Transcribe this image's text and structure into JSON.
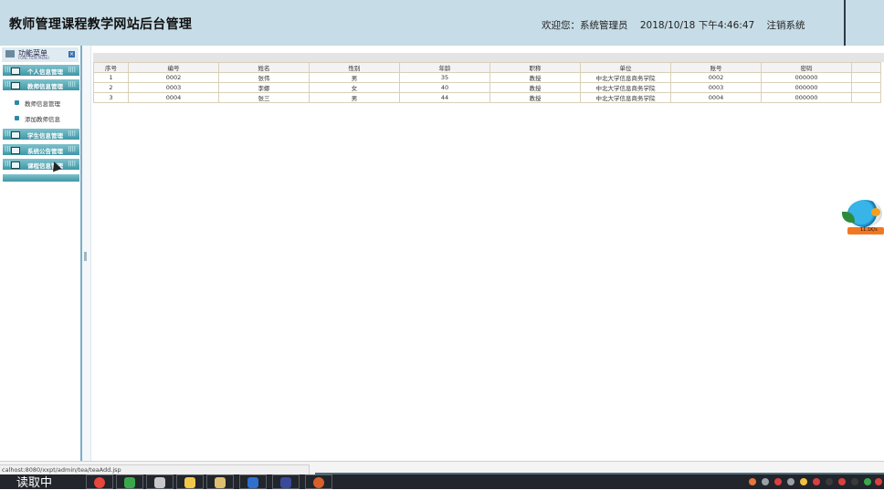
{
  "header": {
    "title": "教师管理课程教学网站后台管理",
    "welcome": "欢迎您：系统管理员",
    "datetime": "2018/10/18 下午4:46:47",
    "logout": "注销系统"
  },
  "sidebar": {
    "menu_title": "功能菜单",
    "menu_subtitle": "FUNCTION MENU",
    "groups": [
      {
        "label": "个人信息管理"
      },
      {
        "label": "教师信息管理",
        "children": [
          {
            "label": "教师信息管理"
          },
          {
            "label": "添加教师信息"
          }
        ]
      },
      {
        "label": "学生信息管理"
      },
      {
        "label": "系统公告管理"
      },
      {
        "label": "课程信息管理"
      }
    ]
  },
  "table": {
    "headers": [
      "序号",
      "编号",
      "姓名",
      "性别",
      "年龄",
      "职称",
      "单位",
      "账号",
      "密码",
      ""
    ],
    "rows": [
      [
        "1",
        "0002",
        "张伟",
        "男",
        "35",
        "教授",
        "中北大学信息商务学院",
        "0002",
        "000000",
        ""
      ],
      [
        "2",
        "0003",
        "李娜",
        "女",
        "40",
        "教授",
        "中北大学信息商务学院",
        "0003",
        "000000",
        ""
      ],
      [
        "3",
        "0004",
        "张三",
        "男",
        "44",
        "教授",
        "中北大学信息商务学院",
        "0004",
        "000000",
        ""
      ]
    ]
  },
  "widget": {
    "speed": "11.1K/s"
  },
  "statusbar": {
    "url": "calhost:8080/xxpt/admin/tea/teaAdd.jsp"
  },
  "taskbar": {
    "start_text": "读取中",
    "apps": [
      {
        "icon": "chrome-icon",
        "color": "#e8453c"
      },
      {
        "icon": "browser-green-icon",
        "color": "#3aa84a"
      },
      {
        "icon": "chart-app-icon",
        "color": "#c8c8c8"
      },
      {
        "icon": "folder-icon",
        "color": "#f2c84b"
      },
      {
        "icon": "document-icon",
        "color": "#e0c070"
      },
      {
        "icon": "vpn-shield-icon",
        "color": "#2f6fd0"
      },
      {
        "icon": "eclipse-icon",
        "color": "#3a4a9a"
      },
      {
        "icon": "game-app-icon",
        "color": "#d9602a"
      }
    ]
  },
  "colors": {
    "header_bg": "#c6dce6",
    "menu_teal": "#3f97a6",
    "table_border": "#d9d0b8",
    "taskbar_bg": "#22252b"
  }
}
